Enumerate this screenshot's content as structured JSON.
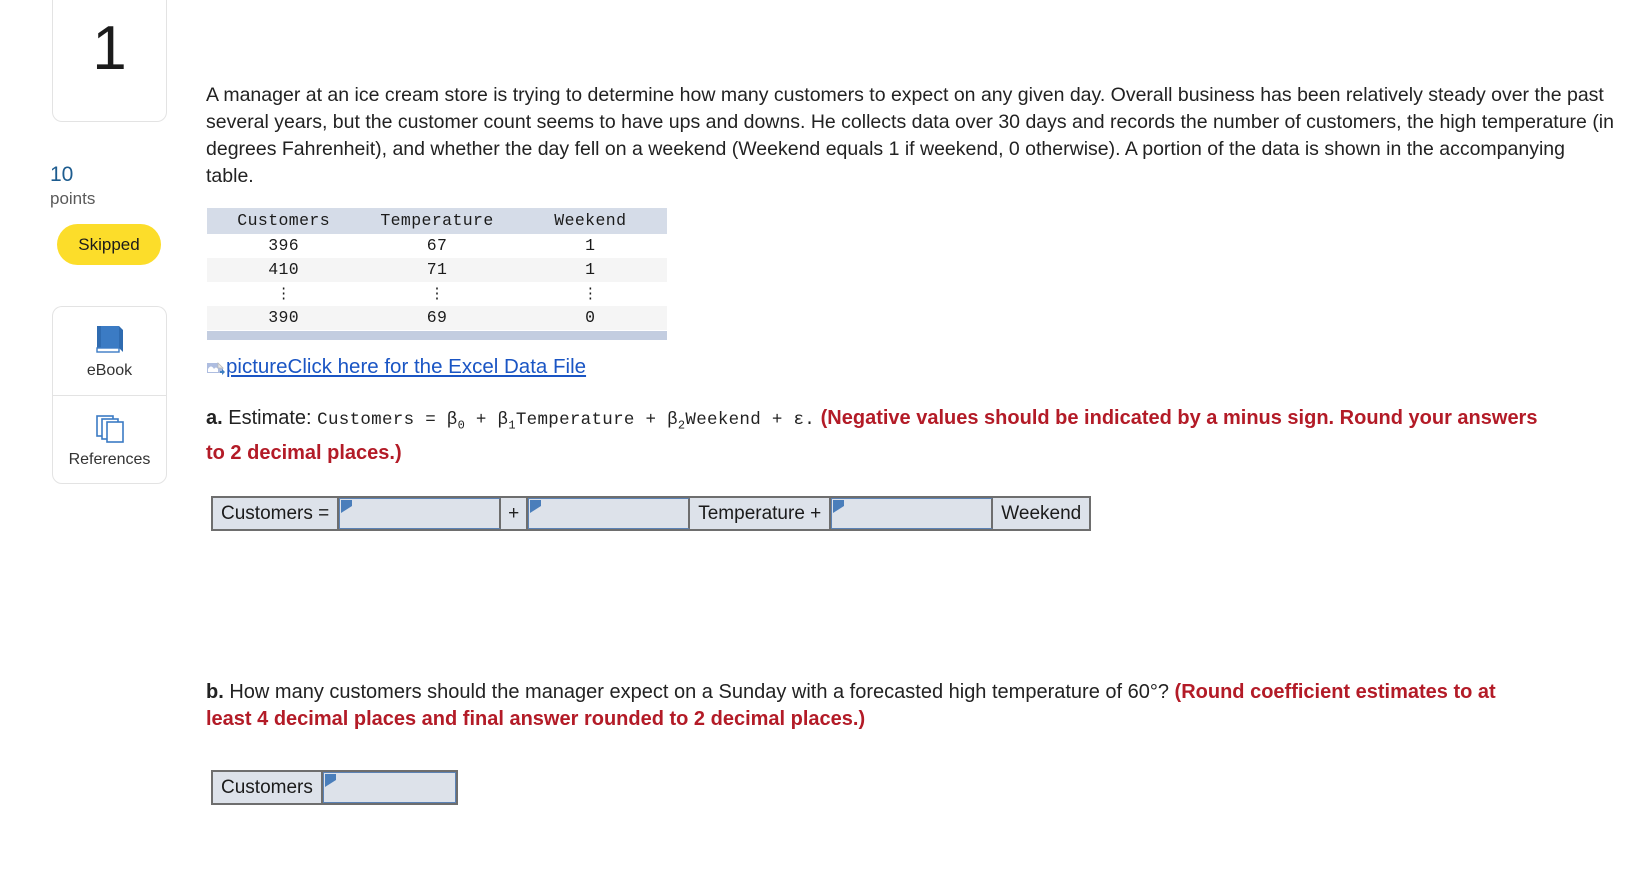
{
  "sidebar": {
    "question_number": "1",
    "points_value": "10",
    "points_label": "points",
    "status_badge": "Skipped",
    "tools": [
      {
        "label": "eBook",
        "icon": "book-icon"
      },
      {
        "label": "References",
        "icon": "pages-stack-icon"
      }
    ]
  },
  "main": {
    "prompt": "A manager at an ice cream store is trying to determine how many customers to expect on any given day. Overall business has been relatively steady over the past several years, but the customer count seems to have ups and downs. He collects data over 30 days and records the number of customers, the high temperature (in degrees Fahrenheit), and whether the day fell on a weekend (Weekend equals 1 if weekend, 0 otherwise). A portion of the data is shown in the accompanying table.",
    "table": {
      "headers": [
        "Customers",
        "Temperature",
        "Weekend"
      ],
      "rows": [
        [
          "396",
          "67",
          "1"
        ],
        [
          "410",
          "71",
          "1"
        ],
        [
          "⋮",
          "⋮",
          "⋮"
        ],
        [
          "390",
          "69",
          "0"
        ]
      ]
    },
    "excel_link": {
      "alt_text": "picture",
      "text": " Click here for the Excel Data File",
      "icon": "broken-image-icon",
      "color": "#1a55c4"
    },
    "part_a": {
      "label": "a.",
      "lead": "Estimate:",
      "equation_pre": "Customers = ",
      "beta0": "β",
      "beta0_sub": "0",
      "plus1": " + ",
      "beta1": "β",
      "beta1_sub": "1",
      "term1": "Temperature",
      "plus2": " + ",
      "beta2": "β",
      "beta2_sub": "2",
      "term2": "Weekend",
      "plus3": " + ",
      "epsilon": "ε",
      "period": ".",
      "red_note": "(Negative values should be indicated by a minus sign. Round your answers to 2 decimal places.)",
      "red_color": "#b31b27",
      "answer_row": {
        "label_start": "Customers =",
        "input_1_value": "",
        "plus_operator": "+",
        "input_2_value": "",
        "label_mid": "Temperature +",
        "input_3_value": "",
        "label_end": "Weekend"
      }
    },
    "part_b": {
      "label": "b.",
      "text": "How many customers should the manager expect on a Sunday with a forecasted high temperature of 60°?",
      "red_note": "(Round coefficient estimates to at least 4 decimal places and final answer rounded to 2 decimal places.)",
      "answer_row": {
        "label_start": "Customers",
        "input_value": ""
      }
    }
  }
}
